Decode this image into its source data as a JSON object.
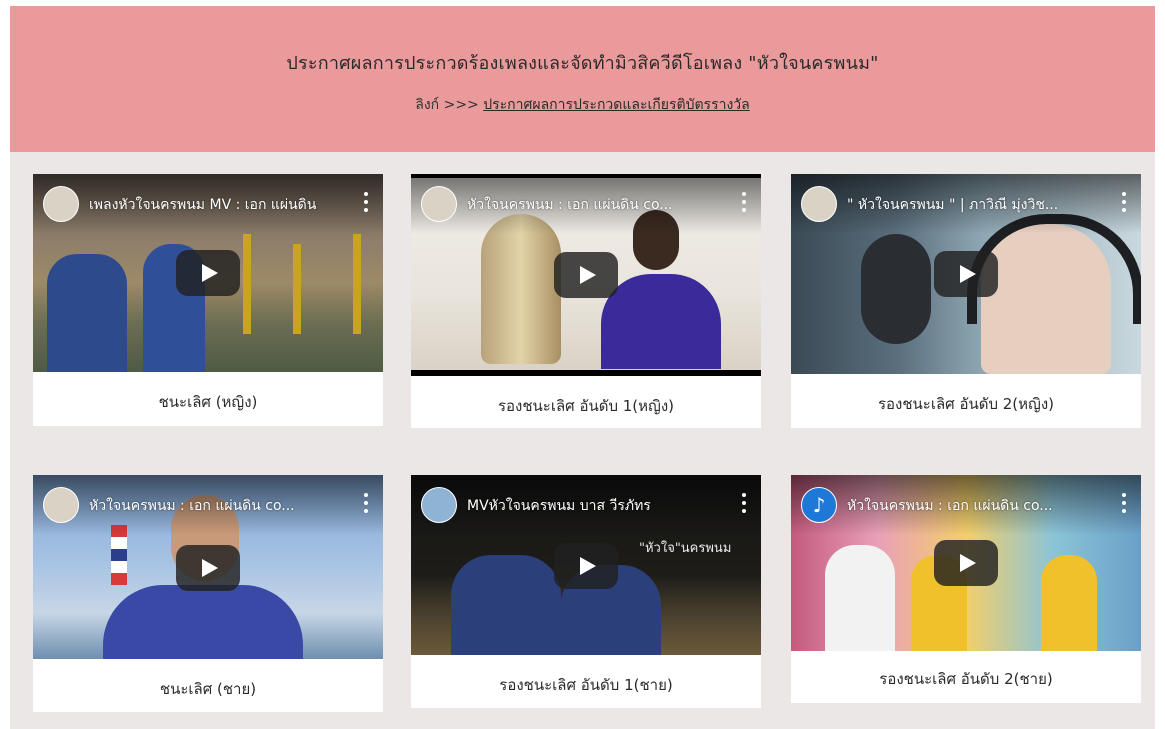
{
  "banner": {
    "title": "ประกาศผลการประกวดร้องเพลงและจัดทำมิวสิควีดีโอเพลง \"หัวใจนครพนม\"",
    "link_prefix": "ลิงก์ >>> ",
    "link_text": "ประกาศผลการประกวดและเกียรติบัตรรางวัล",
    "background_color": "#ea9a9b"
  },
  "videos": [
    {
      "title": "เพลงหัวใจนครพนม MV : เอก แผ่นดิน",
      "caption": "ชนะเลิศ (หญิง)",
      "icon": "play-icon"
    },
    {
      "title": "หัวใจนครพนม : เอก แผ่นดิน co...",
      "caption": "รองชนะเลิศ อันดับ 1(หญิง)",
      "icon": "play-icon"
    },
    {
      "title": "\" หัวใจนครพนม \" | ภาวิณี มุ่งวิช...",
      "caption": "รองชนะเลิศ อันดับ 2(หญิง)",
      "icon": "play-icon"
    },
    {
      "title": "หัวใจนครพนม : เอก แผ่นดิน co...",
      "caption": "ชนะเลิศ (ชาย)",
      "icon": "play-icon"
    },
    {
      "title": "MVหัวใจนครพนม บาส วีรภัทร",
      "caption": "รองชนะเลิศ อันดับ 1(ชาย)",
      "icon": "play-icon"
    },
    {
      "title": "หัวใจนครพนม : เอก แผ่นดิน co...",
      "caption": "รองชนะเลิศ อันดับ 2(ชาย)",
      "icon": "play-icon"
    }
  ]
}
